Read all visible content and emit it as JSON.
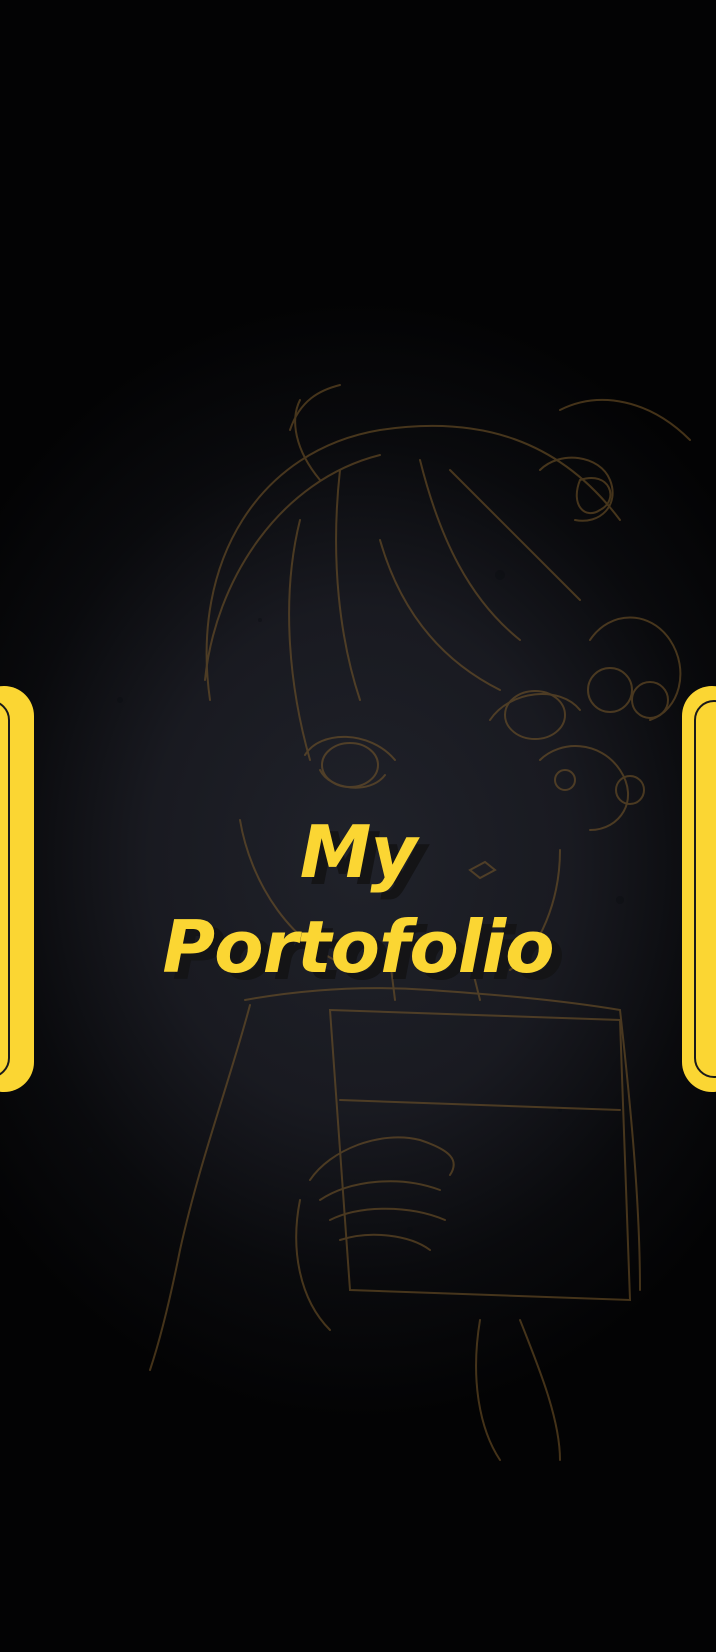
{
  "hero": {
    "title_line1": "My",
    "title_line2": "Portofolio"
  },
  "colors": {
    "background": "#030304",
    "panel": "#1e2028",
    "accent": "#fbd633",
    "lineart": "#7a5a2a"
  },
  "decorations": {
    "illustration": "anime-girl-lineart-icon",
    "left_tab": "yellow-rounded-tab",
    "right_tab": "yellow-rounded-tab"
  }
}
